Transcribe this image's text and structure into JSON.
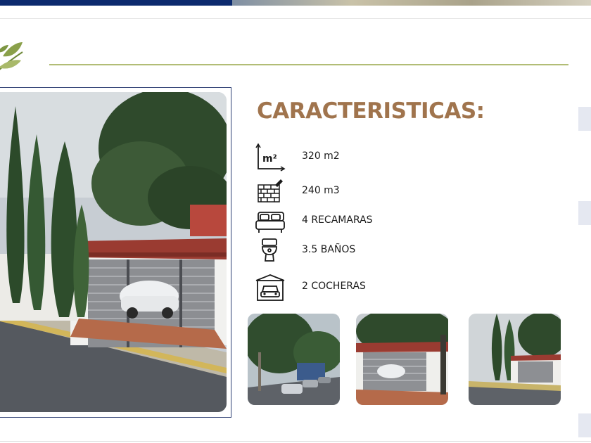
{
  "section": {
    "title": "CARACTERISTICAS:"
  },
  "features": [
    {
      "icon": "area-m2-icon",
      "icon_text": "m²",
      "text": "320 m2"
    },
    {
      "icon": "brick-wall-icon",
      "text": "240 m3"
    },
    {
      "icon": "bed-icon",
      "text": "4 RECAMARAS"
    },
    {
      "icon": "toilet-icon",
      "text": "3.5 BAÑOS"
    },
    {
      "icon": "garage-car-icon",
      "text": "2 COCHERAS"
    }
  ],
  "colors": {
    "title": "#a0744d",
    "accent_line": "#b2bd76",
    "frame": "#2d3f73",
    "top_bar": "#0c2a6e"
  }
}
